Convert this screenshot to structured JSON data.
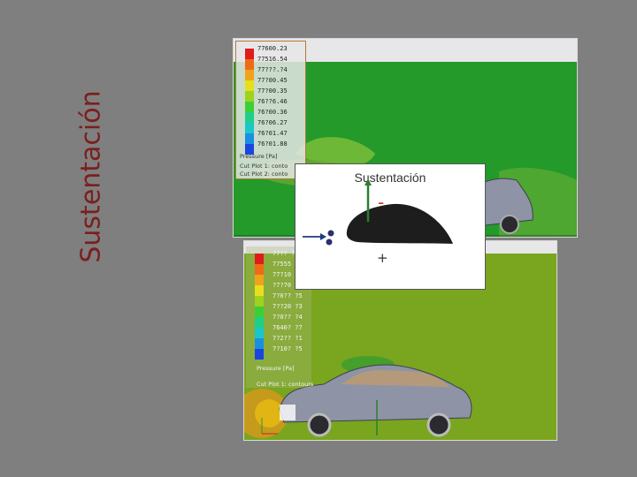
{
  "slide": {
    "title": "Sustentación"
  },
  "top_panel": {
    "legend": {
      "values": [
        "77600.23",
        "77516.54",
        "77???.?4",
        "77?00.45",
        "77?00.35",
        "76??6.46",
        "76?00.36",
        "76?06.27",
        "76?01.47",
        "76?01.88"
      ],
      "label": "Pressure [Pa]",
      "footer_1": "Cut Plot 1: conto",
      "footer_2": "Cut Plot 2: conto"
    }
  },
  "bottom_panel": {
    "legend": {
      "values": [
        "77?? ? ?",
        "77555 ?",
        "77?10 ?",
        "?7?70 ?",
        "7?0?? ?5",
        "7??20 ?3",
        "7?0?? ?4",
        "7640? ?7",
        "7?2?? ?1",
        "7?10? ?5"
      ],
      "label": "Pressure [Pa]",
      "footer": "Cut Plot 1: contours"
    }
  },
  "inset": {
    "title": "Sustentación",
    "minus_sign": "-",
    "plus_sign": "+"
  },
  "colors": {
    "slide_bg": "#7f7f7f",
    "title": "#7b1f1f",
    "field_green": "#239a2a",
    "field_olive": "#7aa51f",
    "car_gray": "#8f93a6",
    "minus_red": "#d62a1e"
  }
}
